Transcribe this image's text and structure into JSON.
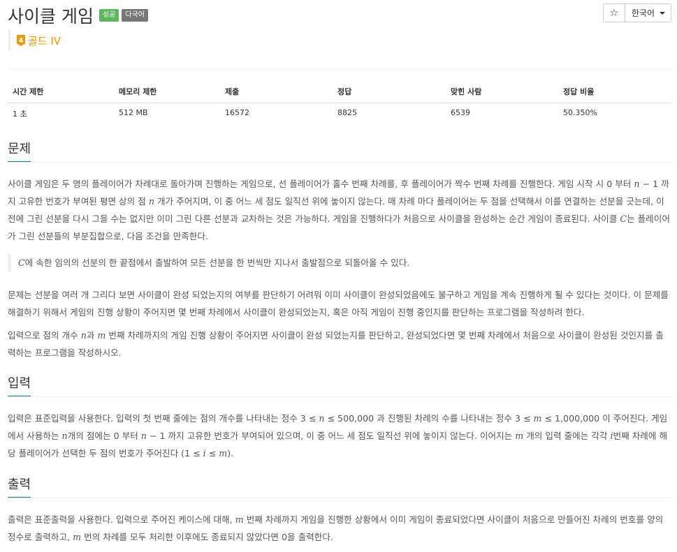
{
  "header": {
    "title": "사이클 게임",
    "badge_success": "성공",
    "badge_multilang": "다국어",
    "star_icon": "☆",
    "language": "한국어"
  },
  "tier": {
    "number": "4",
    "label": "골드 IV",
    "color": "#ec9a00"
  },
  "stats": {
    "headers": [
      "시간 제한",
      "메모리 제한",
      "제출",
      "정답",
      "맞힌 사람",
      "정답 비율"
    ],
    "values": [
      "1 초",
      "512 MB",
      "16572",
      "8825",
      "6539",
      "50.350%"
    ]
  },
  "sections": {
    "problem": "문제",
    "input": "입력",
    "output": "출력"
  },
  "problem": {
    "p1a": "사이클 게임은 두 명의 플레이어가 차례대로 돌아가며 진행하는 게임으로, 선 플레이어가 홀수 번째 차례를, 후 플레이어가 짝수 번째 차례를 진행한다. 게임 시작 시 0 부터 ",
    "p1n1": "n",
    "p1b": " − 1 까지 고유한 번호가 부여된 평면 상의 점 ",
    "p1n2": "n",
    "p1c": " 개가 주어지며, 이 중 어느 세 점도 일직선 위에 놓이지 않는다. 매 차례 마다 플레이어는 두 점을 선택해서 이를 연결하는 선분을 긋는데, 이전에 그린 선분을 다시 그을 수는 없지만 이미 그린 다른 선분과 교차하는 것은 가능하다. 게임을 진행하다가 처음으로 사이클을 완성하는 순간 게임이 종료된다. 사이클 ",
    "p1C": "C",
    "p1d": "는 플레이어가 그린 선분들의 부분집합으로, 다음 조건을 만족한다.",
    "qC": "C",
    "q": "에 속한 임의의 선분의 한 끝점에서 출발하여 모든 선분을 한 번씩만 지나서 출발점으로 되돌아올 수 있다.",
    "p2": "문제는 선분을 여러 개 그리다 보면 사이클이 완성 되었는지의 여부를 판단하기 어려워 이미 사이클이 완성되었음에도 불구하고 게임을 계속 진행하게 될 수 있다는 것이다. 이 문제를 해결하기 위해서 게임의 진행 상황이 주어지면 몇 번째 차례에서 사이클이 완성되었는지, 혹은 아직 게임이 진행 중인지를 판단하는 프로그램을 작성하려 한다.",
    "p3a": "입력으로 점의 개수 ",
    "p3n": "n",
    "p3b": "과 ",
    "p3m": "m",
    "p3c": " 번째 차례까지의 게임 진행 상황이 주어지면 사이클이 완성 되었는지를 판단하고, 완성되었다면 몇 번째 차례에서 처음으로 사이클이 완성된 것인지를 출력하는 프로그램을 작성하시오."
  },
  "input": {
    "a": "입력은 표준입력을 사용한다. 입력의 첫 번째 줄에는 점의 개수를 나타내는 정수 3 ≤ ",
    "n1": "n",
    "b": " ≤ 500,000 과 진행된 차례의 수를 나타내는 정수 3 ≤ ",
    "m1": "m",
    "c": " ≤ 1,000,000 이 주어진다. 게임에서 사용하는 ",
    "n2": "n",
    "d": "개의 점에는 0 부터 ",
    "n3": "n",
    "e": " − 1 까지 고유한 번호가 부여되어 있으며, 이 중 어느 세 점도 일직선 위에 놓이지 않는다. 이어지는 ",
    "m2": "m",
    "f": " 개의 입력 줄에는 각각 ",
    "i1": "i",
    "g": "번째 차례에 해당 플레이어가 선택한 두 점의 번호가 주어진다 (1 ≤ ",
    "i2": "i",
    "h": " ≤ ",
    "m3": "m",
    "j": ")."
  },
  "output": {
    "a": "출력은 표준출력을 사용한다. 입력으로 주어진 케이스에 대해, ",
    "m1": "m",
    "b": " 번째 차례까지 게임을 진행한 상황에서 이미 게임이 종료되었다면 사이클이 처음으로 만들어진 차례의 번호를 양의 정수로 출력하고, ",
    "m2": "m",
    "c": " 번의 차례를 모두 처리한 이후에도 종료되지 않았다면 0을 출력한다."
  }
}
